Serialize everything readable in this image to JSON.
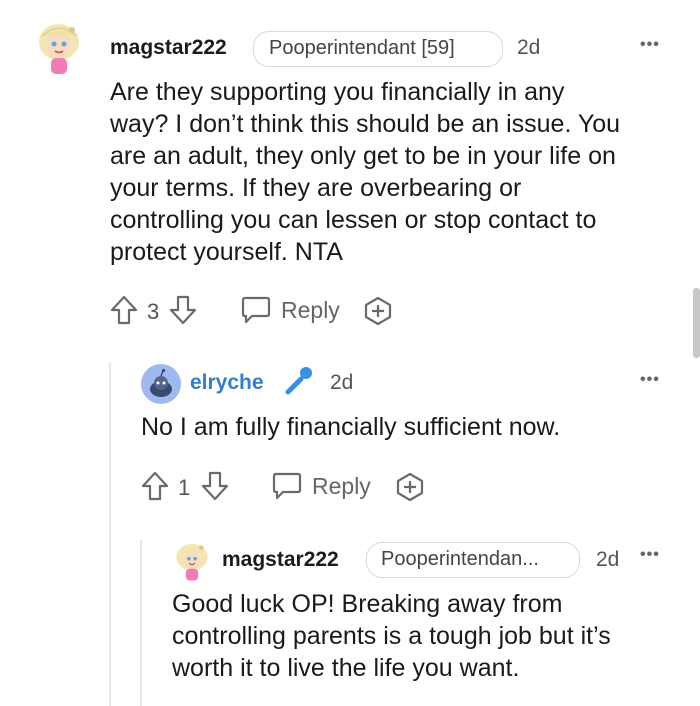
{
  "comments": [
    {
      "username": "magstar222",
      "flair": "Pooperintendant [59]",
      "time": "2d",
      "lines": [
        "Are they supporting you financially in any",
        "way? I don’t think this should be an issue. You",
        "are an adult, they only get to be in your life on",
        "your terms. If they are overbearing or",
        "controlling you can lessen or stop contact to",
        "protect yourself. NTA"
      ],
      "votes": "3",
      "reply_label": "Reply",
      "avatar_icon": "cartoon-girl-avatar-icon"
    },
    {
      "username": "elryche",
      "time": "2d",
      "lines": [
        "No I am fully financially sufficient now."
      ],
      "votes": "1",
      "reply_label": "Reply",
      "avatar_icon": "snoo-avatar-icon",
      "username_color": "#2f7fd0",
      "badge_icon": "microphone-icon"
    },
    {
      "username": "magstar222",
      "flair": "Pooperintendan...",
      "time": "2d",
      "lines": [
        "Good luck OP! Breaking away from",
        "controlling parents is a tough job but it’s",
        "worth it to live the life you want."
      ],
      "avatar_icon": "cartoon-girl-avatar-icon"
    }
  ],
  "more_label": "•••",
  "colors": {
    "text": "#1a1a1b",
    "muted": "#666666",
    "border": "#d7dadc",
    "link": "#2f7fd0"
  }
}
